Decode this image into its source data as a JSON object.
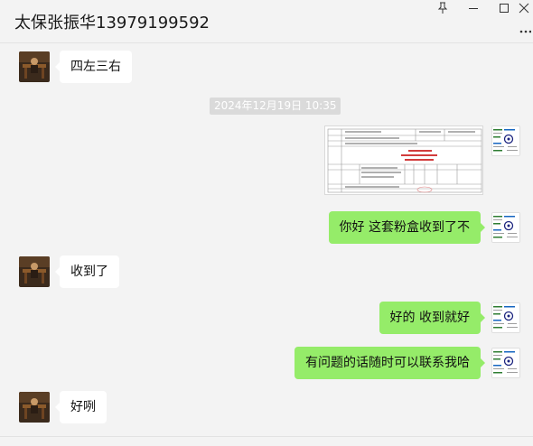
{
  "window": {
    "title": "太保张振华13979199592",
    "controls": [
      "pin-icon",
      "minimize-icon",
      "maximize-icon",
      "close-icon",
      "more-icon"
    ]
  },
  "messages": [
    {
      "side": "left",
      "text": "四左三右"
    },
    {
      "side": "system",
      "text": "2024年12月19日 10:35"
    },
    {
      "side": "right",
      "type": "image",
      "icon": "document-image"
    },
    {
      "side": "right",
      "text": "你好 这套粉盒收到了不"
    },
    {
      "side": "left",
      "text": "收到了"
    },
    {
      "side": "right",
      "text": "好的 收到就好"
    },
    {
      "side": "right",
      "text": "有问题的话随时可以联系我哈"
    },
    {
      "side": "left",
      "text": "好咧"
    }
  ],
  "colors": {
    "background": "#f3f3f3",
    "bubble_outgoing": "#95ec69",
    "bubble_incoming": "#ffffff",
    "timestamp_bg": "#dadada"
  }
}
